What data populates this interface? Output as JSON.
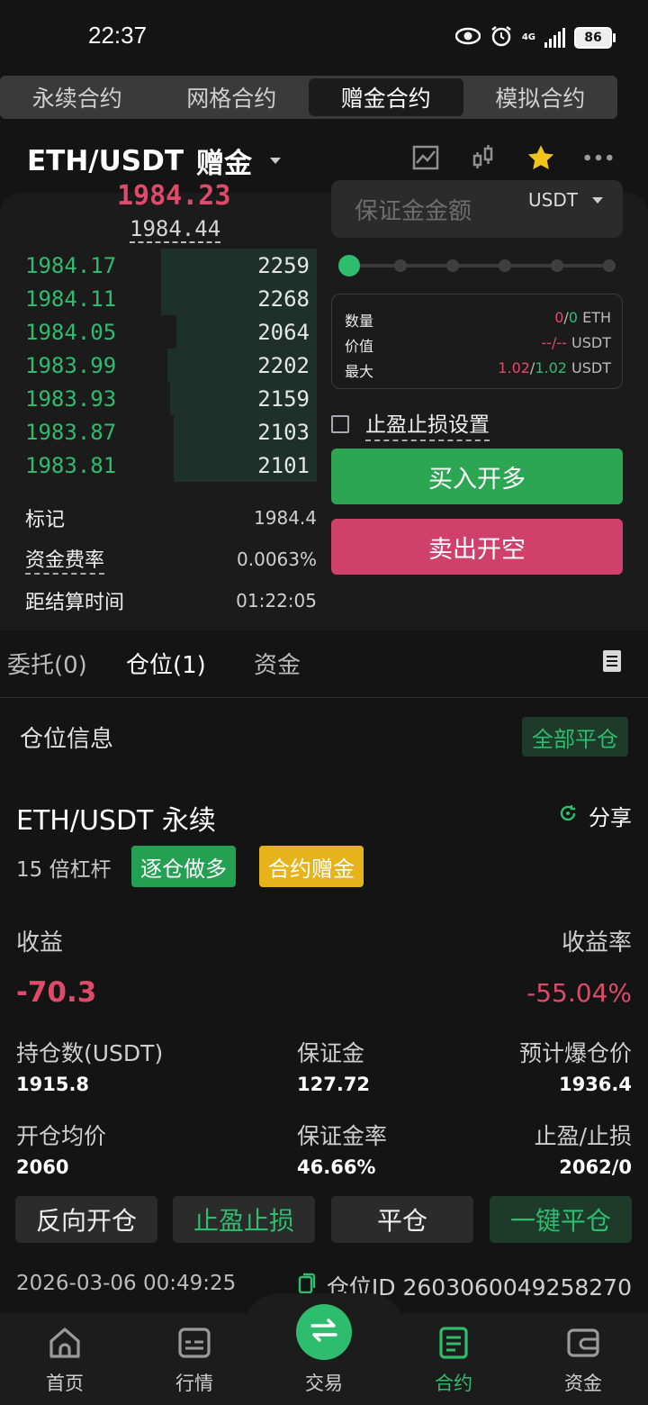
{
  "status_bar": {
    "time": "22:37",
    "network": "4G",
    "battery": "86"
  },
  "top_tabs": [
    {
      "label": "永续合约",
      "active": false
    },
    {
      "label": "网格合约",
      "active": false
    },
    {
      "label": "赠金合约",
      "active": true
    },
    {
      "label": "模拟合约",
      "active": false
    }
  ],
  "pair": {
    "symbol": "ETH/USDT",
    "tag": "赠金"
  },
  "header_icons": [
    "chart-icon",
    "candlestick-icon",
    "star-icon",
    "more-icon"
  ],
  "orderbook": {
    "last_price": "1984.23",
    "mark_price": "1984.44",
    "bids": [
      {
        "price": "1984.17",
        "qty": "2259",
        "depth": 0.52
      },
      {
        "price": "1984.11",
        "qty": "2268",
        "depth": 0.52
      },
      {
        "price": "1984.05",
        "qty": "2064",
        "depth": 0.47
      },
      {
        "price": "1983.99",
        "qty": "2202",
        "depth": 0.5
      },
      {
        "price": "1983.93",
        "qty": "2159",
        "depth": 0.49
      },
      {
        "price": "1983.87",
        "qty": "2103",
        "depth": 0.48
      },
      {
        "price": "1983.81",
        "qty": "2101",
        "depth": 0.48
      }
    ]
  },
  "market_info": {
    "mark_label": "标记",
    "mark_value": "1984.4",
    "funding_label": "资金费率",
    "funding_value": "0.0063%",
    "settle_label": "距结算时间",
    "settle_value": "01:22:05"
  },
  "order_form": {
    "margin_placeholder": "保证金金额",
    "margin_unit": "USDT",
    "slider_level": 0,
    "qty_label": "数量",
    "qty_a": "0",
    "qty_sep": "/",
    "qty_b": "0",
    "qty_unit": "ETH",
    "value_label": "价值",
    "value_val": "--/--",
    "value_unit": "USDT",
    "max_label": "最大",
    "max_a": "1.02",
    "max_sep": "/",
    "max_b": "1.02",
    "max_unit": "USDT",
    "tpsl_label": "止盈止损设置",
    "buy_label": "买入开多",
    "sell_label": "卖出开空"
  },
  "position_tabs": [
    {
      "label": "委托(0)",
      "active": false
    },
    {
      "label": "仓位(1)",
      "active": true
    },
    {
      "label": "资金",
      "active": false
    }
  ],
  "position_section": {
    "title": "仓位信息",
    "close_all": "全部平仓"
  },
  "position": {
    "name": "ETH/USDT 永续",
    "share": "分享",
    "leverage": "15 倍杠杆",
    "badge_mode": "逐仓做多",
    "badge_bonus": "合约赠金",
    "pnl_label": "收益",
    "pnl_value": "-70.3",
    "roe_label": "收益率",
    "roe_value": "-55.04%",
    "size_label": "持仓数(USDT)",
    "size_value": "1915.8",
    "margin_label": "保证金",
    "margin_value": "127.72",
    "liq_label": "预计爆仓价",
    "liq_value": "1936.4",
    "entry_label": "开仓均价",
    "entry_value": "2060",
    "margin_ratio_label": "保证金率",
    "margin_ratio_value": "46.66%",
    "tpsl_label": "止盈/止损",
    "tpsl_value": "2062/0",
    "actions": [
      "反向开仓",
      "止盈止损",
      "平仓",
      "一键平仓"
    ],
    "timestamp": "2026-03-06 00:49:25",
    "position_id": "仓位ID 2603060049258270"
  },
  "bottom_nav": [
    {
      "label": "首页",
      "icon": "home-icon",
      "active": false
    },
    {
      "label": "行情",
      "icon": "market-icon",
      "active": false
    },
    {
      "label": "交易",
      "icon": "swap-icon",
      "active": false
    },
    {
      "label": "合约",
      "icon": "contract-icon",
      "active": true
    },
    {
      "label": "资金",
      "icon": "wallet-icon",
      "active": false
    }
  ],
  "colors": {
    "green": "#2ebd6f",
    "red": "#e04a6a",
    "yellow": "#e6b31a",
    "bg": "#141414"
  }
}
